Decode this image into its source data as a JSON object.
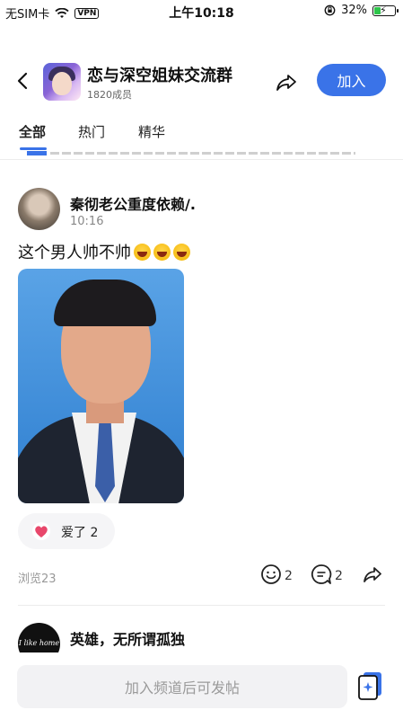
{
  "status_bar": {
    "carrier": "无SIM卡",
    "vpn": "VPN",
    "time": "上午10:18",
    "battery": "32%",
    "battery_level": 0.32
  },
  "header": {
    "group_name": "恋与深空姐妹交流群",
    "members": "1820成员",
    "join_label": "加入"
  },
  "tabs": [
    {
      "label": "全部",
      "active": true
    },
    {
      "label": "热门",
      "active": false
    },
    {
      "label": "精华",
      "active": false
    }
  ],
  "post": {
    "author": "秦彻老公重度依赖/.",
    "time": "10:16",
    "text": "这个男人帅不帅",
    "reaction_label": "爱了 2",
    "views": "浏览23",
    "emoji_count": "2",
    "comment_count": "2"
  },
  "next_post": {
    "author": "英雄，无所谓孤独",
    "avatar_text": "I like home"
  },
  "composer": {
    "placeholder": "加入频道后可发帖"
  },
  "colors": {
    "accent": "#3a73e8"
  }
}
